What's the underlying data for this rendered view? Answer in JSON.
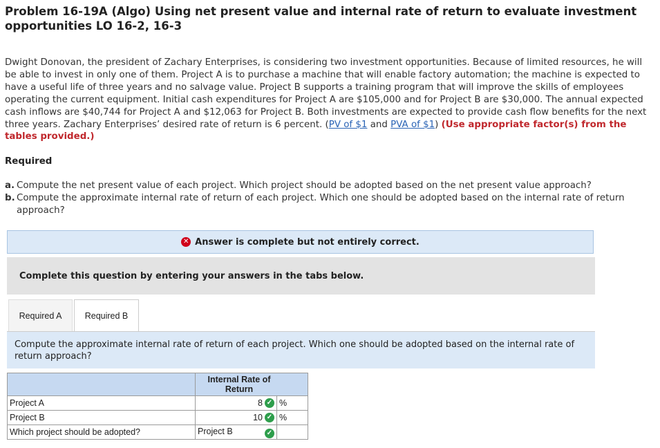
{
  "title": "Problem 16-19A (Algo) Using net present value and internal rate of return to evaluate investment opportunities LO 16-2, 16-3",
  "intro": {
    "text": "Dwight Donovan, the president of Zachary Enterprises, is considering two investment opportunities. Because of limited resources, he will be able to invest in only one of them. Project A is to purchase a machine that will enable factory automation; the machine is expected to have a useful life of three years and no salvage value. Project B supports a training program that will improve the skills of employees operating the current equipment. Initial cash expenditures for Project A are $105,000 and for Project B are $30,000. The annual expected cash inflows are $40,744 for Project A and $12,063 for Project B. Both investments are expected to provide cash flow benefits for the next three years. Zachary Enterprises’ desired rate of return is 6 percent. (",
    "link_pv": "PV of $1",
    "and": " and ",
    "link_pva": "PVA of $1",
    "close": ") ",
    "note": "(Use appropriate factor(s) from the tables provided.)"
  },
  "required_heading": "Required",
  "questions": [
    {
      "label": "a.",
      "text": "Compute the net present value of each project. Which project should be adopted based on the net present value approach?"
    },
    {
      "label": "b.",
      "text": "Compute the approximate internal rate of return of each project. Which one should be adopted based on the internal rate of return approach?"
    }
  ],
  "banner": {
    "icon": "error-icon",
    "text": "Answer is complete but not entirely correct."
  },
  "instruction": "Complete this question by entering your answers in the tabs below.",
  "tabs": [
    {
      "label": "Required A"
    },
    {
      "label": "Required B"
    }
  ],
  "prompt": "Compute the approximate internal rate of return of each project. Which one should be adopted based on the internal rate of return approach?",
  "table": {
    "header": "Internal Rate of Return",
    "rows": [
      {
        "label": "Project A",
        "value": "8",
        "unit": "%"
      },
      {
        "label": "Project B",
        "value": "10",
        "unit": "%"
      },
      {
        "label": "Which project should be adopted?",
        "value": "Project B"
      }
    ],
    "check_icon": "check-circle-icon"
  },
  "colors": {
    "banner_bg": "#dce9f7",
    "header_bg": "#c6d9f1",
    "error": "#d0021b",
    "correct": "#2e9e4c",
    "link": "#2a63b5",
    "note": "#c0282d"
  }
}
